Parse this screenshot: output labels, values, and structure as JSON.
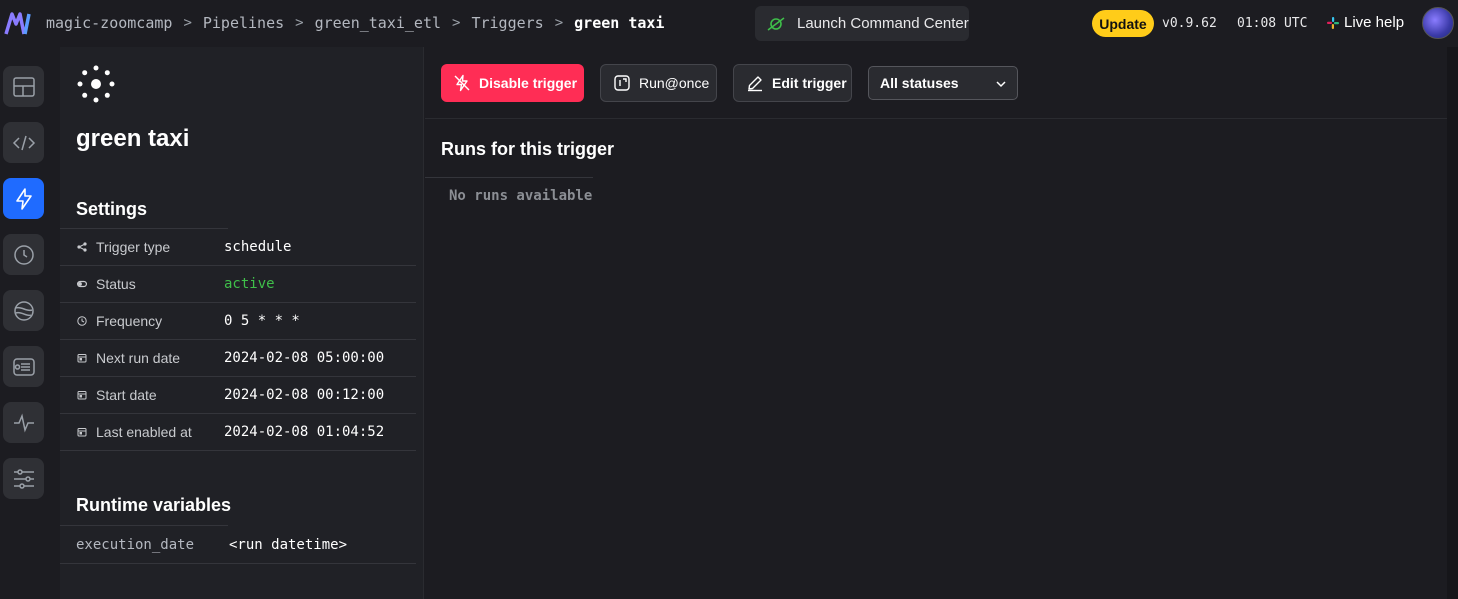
{
  "header": {
    "breadcrumb": [
      "magic-zoomcamp",
      "Pipelines",
      "green_taxi_etl",
      "Triggers",
      "green taxi"
    ],
    "command_center_label": "Launch Command Center",
    "update_label": "Update",
    "version": "v0.9.62",
    "time": "01:08 UTC",
    "live_help_label": "Live help"
  },
  "nav": {
    "items": [
      "layout-icon",
      "code-icon",
      "lightning-icon",
      "clock-icon",
      "globe-icon",
      "terminal-icon",
      "pulse-icon",
      "sliders-icon"
    ],
    "active_index": 2
  },
  "trigger": {
    "name": "green taxi",
    "settings_title": "Settings",
    "settings": [
      {
        "label": "Trigger type",
        "value": "schedule",
        "icon": "share-icon"
      },
      {
        "label": "Status",
        "value": "active",
        "icon": "toggle-icon"
      },
      {
        "label": "Frequency",
        "value": "0 5 * * *",
        "icon": "clock-icon"
      },
      {
        "label": "Next run date",
        "value": "2024-02-08 05:00:00",
        "icon": "calendar-icon"
      },
      {
        "label": "Start date",
        "value": "2024-02-08 00:12:00",
        "icon": "calendar-icon"
      },
      {
        "label": "Last enabled at",
        "value": "2024-02-08 01:04:52",
        "icon": "calendar-icon"
      }
    ],
    "runtime_title": "Runtime variables",
    "runtime_variables": [
      {
        "name": "execution_date",
        "value": "<run datetime>"
      }
    ]
  },
  "toolbar": {
    "disable_label": "Disable trigger",
    "run_label": "Run@once",
    "edit_label": "Edit trigger",
    "status_filter": "All statuses"
  },
  "runs": {
    "title": "Runs for this trigger",
    "empty_message": "No runs available"
  },
  "colors": {
    "accent": "#1f6bff",
    "danger": "#ff2d55",
    "update": "#ffcc19",
    "status_active": "#3fbf4a"
  }
}
